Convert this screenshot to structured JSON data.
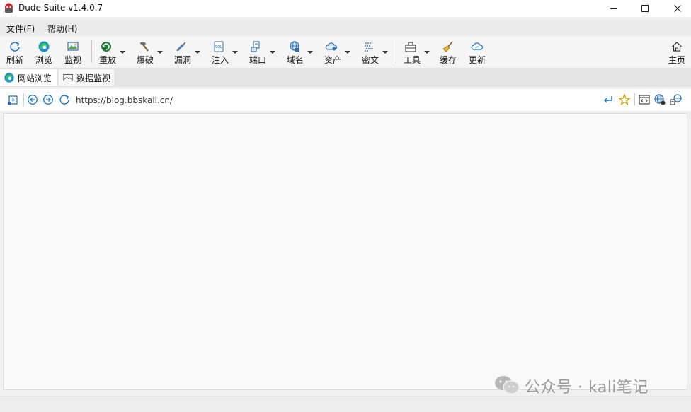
{
  "window": {
    "title": "Dude Suite v1.4.0.7",
    "controls": [
      "minimize",
      "maximize",
      "close"
    ]
  },
  "menu": {
    "file": "文件(F)",
    "help": "帮助(H)"
  },
  "toolbar": {
    "refresh": "刷新",
    "browse": "浏览",
    "monitor": "监视",
    "replay": "重放",
    "bruteforce": "爆破",
    "vuln": "漏洞",
    "inject": "注入",
    "port": "端口",
    "domain": "域名",
    "asset": "资产",
    "cipher": "密文",
    "tools": "工具",
    "cache": "缓存",
    "update": "更新",
    "home": "主页"
  },
  "tabs": {
    "web": "网站浏览",
    "monitor": "数据监视"
  },
  "addressbar": {
    "url": "https://blog.bbskali.cn/"
  },
  "watermark": {
    "text": "公众号 · kali笔记"
  },
  "colors": {
    "accent_blue": "#1a73c8",
    "edge_green": "#2ea043",
    "star_gold": "#c99a06"
  }
}
